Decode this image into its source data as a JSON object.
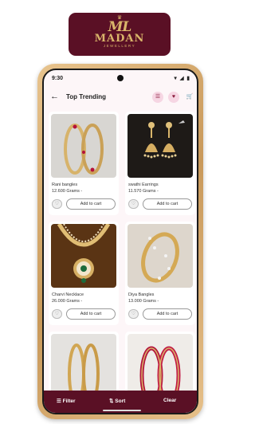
{
  "logo": {
    "monogram": "ML",
    "brand": "MADAN",
    "tagline": "JEWELLERY"
  },
  "status": {
    "time": "9:30",
    "icons": "▾◢▮"
  },
  "appbar": {
    "title": "Top Trending",
    "back_icon": "arrow-left-icon",
    "actions": [
      "filter-icon",
      "heart-icon",
      "cart-icon"
    ]
  },
  "products": [
    {
      "name": "Rani bangles",
      "price": "12.600 Grams -",
      "cart_label": "Add to cart"
    },
    {
      "name": "swathi Earrings",
      "price": "11.570 Grams -",
      "cart_label": "Add to cart"
    },
    {
      "name": "Charvi Necklace",
      "price": "26.000 Grams -",
      "cart_label": "Add to cart"
    },
    {
      "name": "Diya Bangles",
      "price": "13.000 Grams -",
      "cart_label": "Add to cart"
    },
    {
      "name": "",
      "price": "",
      "cart_label": ""
    },
    {
      "name": "",
      "price": "",
      "cart_label": ""
    }
  ],
  "bottom_bar": {
    "filter": "Filter",
    "sort": "Sort",
    "clear": "Clear"
  },
  "colors": {
    "brand": "#5a1025",
    "gold": "#d9b56a",
    "pink": "#f6d6e3"
  }
}
